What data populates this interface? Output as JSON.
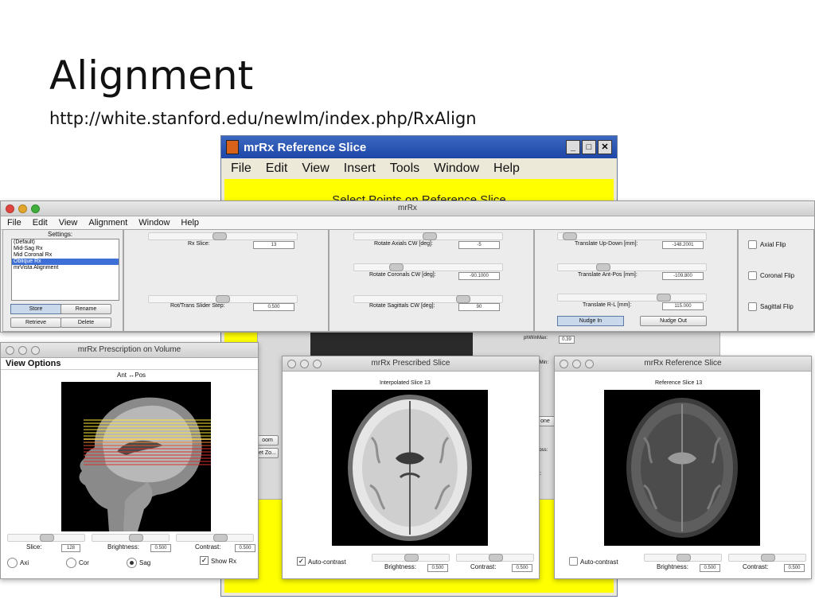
{
  "slide": {
    "title": "Alignment",
    "url": "http://white.stanford.edu/newlm/index.php/RxAlign"
  },
  "back_window": {
    "title": "mrRx Reference Slice",
    "menu": [
      "File",
      "Edit",
      "View",
      "Insert",
      "Tools",
      "Window",
      "Help"
    ],
    "yellow_title": "Select Points on Reference Slice",
    "buttons": {
      "minimize": "_",
      "maximize": "□",
      "close": "✕"
    }
  },
  "mrrx": {
    "title": "mrRx",
    "menu": [
      "File",
      "Edit",
      "View",
      "Alignment",
      "Window",
      "Help"
    ],
    "settings_label": "Settings:",
    "settings_items": [
      "(Default)",
      "Mid-Sag Rx",
      "Mid Coronal Rx",
      "Oblique Rx",
      "mrVista Alignment"
    ],
    "settings_selected_index": 3,
    "store": "Store",
    "rename": "Rename",
    "retrieve": "Retrieve",
    "delete": "Delete",
    "rx_slice_label": "Rx Slice:",
    "rx_slice_value": "13",
    "step_label": "Rot/Trans Slider Step:",
    "step_value": "0.500",
    "rot_axials_label": "Rotate Axials CW [deg]:",
    "rot_axials_value": "-5",
    "rot_coronals_label": "Rotate Coronals CW [deg]:",
    "rot_coronals_value": "-90.1000",
    "rot_sagittals_label": "Rotate Sagittals CW [deg]:",
    "rot_sagittals_value": "90",
    "trans_ud_label": "Translate Up-Down [mm]:",
    "trans_ud_value": "-148.2001",
    "trans_ap_label": "Translate Ant-Pos [mm]:",
    "trans_ap_value": "-109.800",
    "trans_rl_label": "Translate R-L [mm]:",
    "trans_rl_value": "115.000",
    "nudge_in": "Nudge In",
    "nudge_out": "Nudge Out",
    "axial_flip": "Axial Flip",
    "coronal_flip": "Coronal Flip",
    "sagittal_flip": "Sagittal Flip"
  },
  "prescription": {
    "title": "mrRx Prescription on Volume",
    "view_options": "View Options",
    "orientation_label": "Ant ↔Pos",
    "slice_label": "Slice:",
    "slice_value": "128",
    "brightness_label": "Brightness:",
    "brightness_value": "0.500",
    "contrast_label": "Contrast:",
    "contrast_value": "0.500",
    "radio_axi": "Axi",
    "radio_cor": "Cor",
    "radio_sag": "Sag",
    "show_rx": "Show Rx",
    "selected_view": "Sag",
    "show_rx_checked": true
  },
  "prescribed": {
    "title": "mrRx Prescribed Slice",
    "caption": "Interpolated Slice 13",
    "auto_contrast": "Auto-contrast",
    "brightness_label": "Brightness:",
    "brightness_value": "0.500",
    "contrast_label": "Contrast:",
    "contrast_value": "0.500",
    "auto_contrast_checked": true
  },
  "reference": {
    "title": "mrRx Reference Slice",
    "caption": "Reference Slice 13",
    "auto_contrast": "Auto-contrast",
    "brightness_label": "Brightness:",
    "brightness_value": "0.500",
    "contrast_label": "Contrast:",
    "contrast_value": "0.500",
    "auto_contrast_checked": false
  },
  "midstrip": {
    "win_max_label": "phWinMax:",
    "win_max_value": "0.39",
    "win_min_label": "hWinMin:",
    "zoom_label": "oom",
    "set_zoom_label": "et Zo...",
    "none_label": "one",
    "misc_label_1": "noss:",
    "misc_label_2": "st:"
  },
  "colors": {
    "highlight": "#3d6fd6",
    "rx_lines_yellow": "#ffe23a",
    "rx_lines_red": "#d8322a",
    "back_yellow": "#ffff00"
  }
}
